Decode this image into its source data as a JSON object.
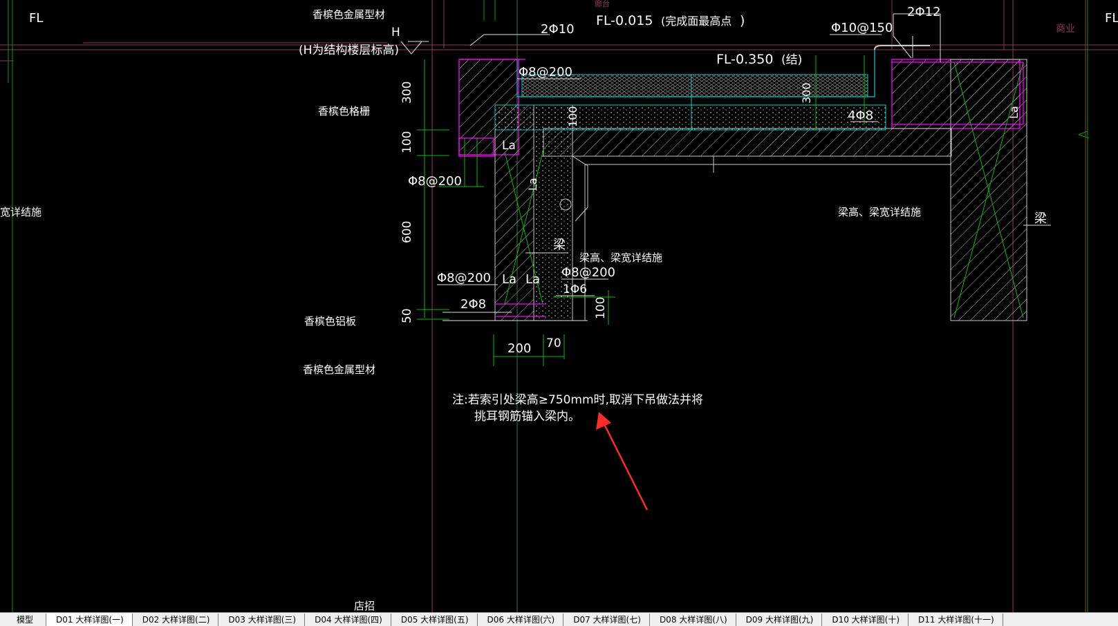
{
  "drawing": {
    "top_fl_left": "FL",
    "top_fl_right": "FL",
    "top_partial": "廊台",
    "right_partial": "商业",
    "label_metal_profile_top": "香槟色金属型材",
    "label_h_note": "(H为结构楼层标高)",
    "label_h": "H",
    "label_grille": "香槟色格栅",
    "label_left_edge": "宽详结施",
    "label_aluminum_panel": "香槟色铝板",
    "label_metal_profile_bottom": "香槟色金属型材",
    "label_bottom": "店招",
    "elev_finish": "FL-0.015",
    "elev_finish_note": "(完成面最高点",
    "elev_finish_close": ")",
    "elev_struct": "FL-0.350",
    "elev_struct_note": "(结)",
    "rebar_2phi10": "2Φ10",
    "rebar_phi10_150": "Φ10@150",
    "rebar_2phi12": "2Φ12",
    "rebar_phi8_200_top": "Φ8@200",
    "rebar_4phi8": "4Φ8",
    "rebar_phi8_200_left": "Φ8@200",
    "rebar_phi8_200_lower": "Φ8@200",
    "rebar_phi8_200_mid": "Φ8@200",
    "rebar_1phi6": "1Φ6",
    "rebar_2phi8": "2Φ8",
    "la_1": "La",
    "la_2": "La",
    "la_3": "La",
    "la_4": "La",
    "la_5": "La",
    "beam_left": "梁",
    "beam_right": "梁",
    "beam_note_left": "梁高、梁宽详结施",
    "beam_note_right": "梁高、梁宽详结施",
    "dim_300_left": "300",
    "dim_100_left": "100",
    "dim_600": "600",
    "dim_50": "50",
    "dim_100_slab": "100",
    "dim_300_right": "300",
    "dim_100_bottom": "100",
    "dim_200": "200",
    "dim_70": "70",
    "note_line1": "注:若索引处梁高≥750mm时,取消下吊做法并将",
    "note_line2": "挑耳钢筋锚入梁内。"
  },
  "colors": {
    "canvas_bg": "#000000",
    "magenta": "#ff00ff",
    "green": "#00c000",
    "cyan": "#00d0d0",
    "white": "#ffffff",
    "maroon": "#8a3a5a",
    "arrow": "#ff2a2a"
  },
  "tabs": [
    {
      "label": "模型"
    },
    {
      "label": "D01 大样详图(一)"
    },
    {
      "label": "D02 大样详图(二)"
    },
    {
      "label": "D03 大样详图(三)"
    },
    {
      "label": "D04 大样详图(四)"
    },
    {
      "label": "D05 大样详图(五)"
    },
    {
      "label": "D06 大样详图(六)"
    },
    {
      "label": "D07 大样详图(七)"
    },
    {
      "label": "D08 大样详图(八)"
    },
    {
      "label": "D09 大样详图(九)"
    },
    {
      "label": "D10 大样详图(十)"
    },
    {
      "label": "D11 大样详图(十一)"
    }
  ],
  "active_tab": "D01 大样详图(一)"
}
